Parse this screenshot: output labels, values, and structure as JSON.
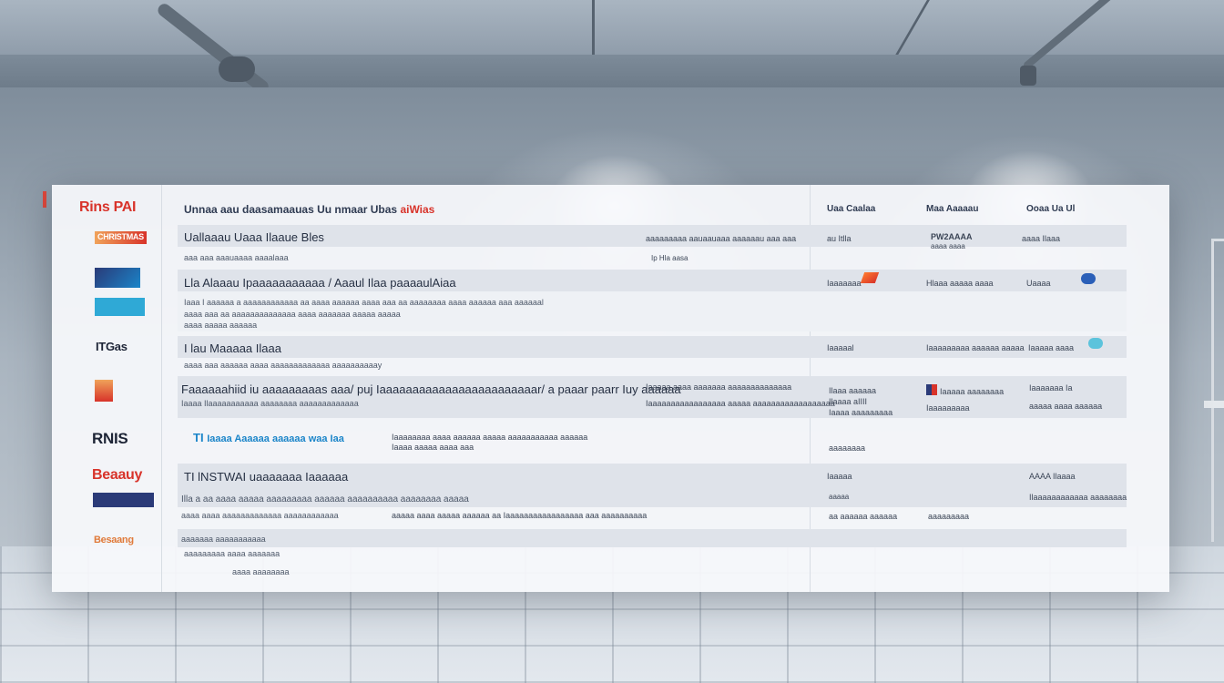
{
  "colors": {
    "accent_red": "#d8332a",
    "accent_blue": "#1b85c9",
    "navy": "#2a3a78",
    "band_gray": "#dfe3ea"
  },
  "header": {
    "logo": "Rins PAI",
    "title": "Unnaa aau daasamaauas Uu nmaar Ubas ",
    "title_accent": "aiWias",
    "col1": "Uaa Caalaa",
    "col2": "Maa Aaaaau",
    "col3": "Ooaa Ua Ul"
  },
  "rows": [
    {
      "logo": "CHRISTMAS",
      "title": "Uallaaau Uaaa Ilaaue Bles",
      "desc": "aaa aaa aaauaaaa aaaalaaa",
      "middle": "aaaaaaaaa aauaauaaa aaaaaau aaa aaa",
      "sub_middle": "Ip Hla aasa",
      "col1": "au Itlla",
      "col2": "PW2AAAA",
      "col2_b": "aaaa aaaa",
      "col3": "aaaa Ilaaa"
    },
    {
      "logo": "",
      "title": "Lla Alaaau Ipaaaaaaaaaaa / Aaaul Ilaa paaaaulAiaa",
      "desc": "Iaaa I aaaaaa a aaaaaaaaaaaa aa aaaa aaaaaa aaaa aaa aa aaaaaaaa aaaa aaaaaa aaa aaaaaal",
      "desc2": "aaaa aaa aa aaaaaaaaaaaaaa aaaa aaaaaaa aaaaa aaaaa",
      "desc3": "aaaa aaaaa aaaaaa",
      "col1": "Iaaaaaaa",
      "col2": "Hlaaa aaaaa aaaa",
      "col3": "Uaaaa"
    },
    {
      "logo": "ITGas",
      "title": "I lau Maaaaa Ilaaa",
      "desc": "aaaa aaa aaaaaa aaaa aaaaaaaaaaaaa aaaaaaaaaay",
      "col1": "Iaaaaal",
      "col2": "Iaaaaaaaaa aaaaaa aaaaa",
      "col3": "Iaaaaa aaaa"
    },
    {
      "logo": "",
      "title": "Faaaaaahiid iu aaaaaaaaas aaa/ puj Iaaaaaaaaaaaaaaaaaaaaaaaar/ a paaar paarr Iuy aaaaaa",
      "desc": "Iaaaa Ilaaaaaaaaaaa aaaaaaaa aaaaaaaaaaaaa",
      "middle": "Iaaaaa aaaa aaaaaaa aaaaaaaaaaaaaa",
      "middle2": "Iaaaaaaaaaaaaaaaaa aaaaa aaaaaaaaaaaaaaaaaa",
      "col1": "Ilaaa aaaaaa",
      "col1_b": "Ilaaaa aIIII",
      "col1_c": "Iaaaa aaaaaaaaa",
      "col2": "Iaaaaa aaaaaaaa",
      "col2_b": "Iaaaaaaaaa",
      "col3": "Iaaaaaaa Ia",
      "col3_b": "aaaaa aaaa aaaaaa"
    },
    {
      "logo": "RNIS",
      "title_prefix": "TI",
      "title": "Iaaaa Aaaaaa aaaaaa waa Iaa",
      "middle": "Iaaaaaaaa aaaa aaaaaa aaaaa aaaaaaaaaaa aaaaaa",
      "middle2": "Iaaaa aaaaa aaaa aaa",
      "col1": "aaaaaaaa"
    },
    {
      "logo": "Beaauy",
      "title": "TI lNSTWAI uaaaaaaa Iaaaaaa",
      "desc": "Illa a aa aaaa aaaaa aaaaaaaaa aaaaaa aaaaaaaaaa aaaaaaaa aaaaa",
      "desc2": "aaaa aaaa aaaaaaaaaaaaa aaaaaaaaaaaa",
      "middle": "aaaaa aaaa aaaaa aaaaaa aa Iaaaaaaaaaaaaaaaaa aaa aaaaaaaaaa",
      "col1": "Iaaaaa",
      "col1_b": "aaaaa",
      "col1_c": "aa aaaaaa aaaaaa",
      "col2": "aaaaaaaaa",
      "col3": "AAAA Ilaaaa",
      "col3_b": "Ilaaaaaaaaaaaa aaaaaaaa"
    },
    {
      "logo": "Besaang",
      "title": "aaaaaaa aaaaaaaaaaa",
      "desc": "aaaaaaaaa aaaa aaaaaaa",
      "desc2": "aaaa aaaaaaaa"
    }
  ]
}
